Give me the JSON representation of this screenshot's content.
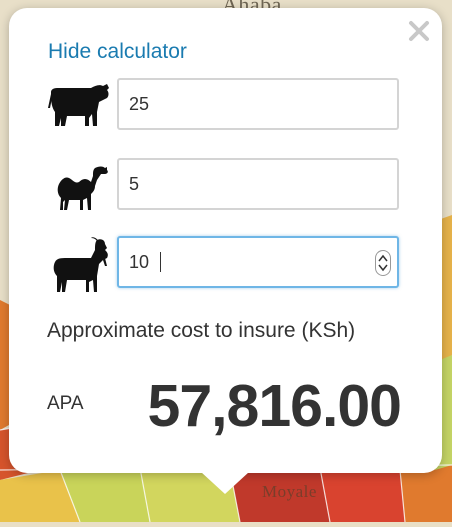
{
  "map": {
    "town_labels": [
      "Ahaba",
      "Moyale"
    ]
  },
  "calculator": {
    "hide_label": "Hide calculator",
    "close_icon": "close-icon",
    "rows": [
      {
        "animal": "cattle-icon",
        "value": "25"
      },
      {
        "animal": "camel-icon",
        "value": "5"
      },
      {
        "animal": "goat-icon",
        "value": "10"
      }
    ],
    "cost_label": "Approximate cost to insure (KSh)",
    "product": "APA",
    "cost_value": "57,816.00"
  },
  "colors": {
    "link": "#1a7bb0",
    "focus": "#6fb6e6",
    "text": "#333333"
  }
}
